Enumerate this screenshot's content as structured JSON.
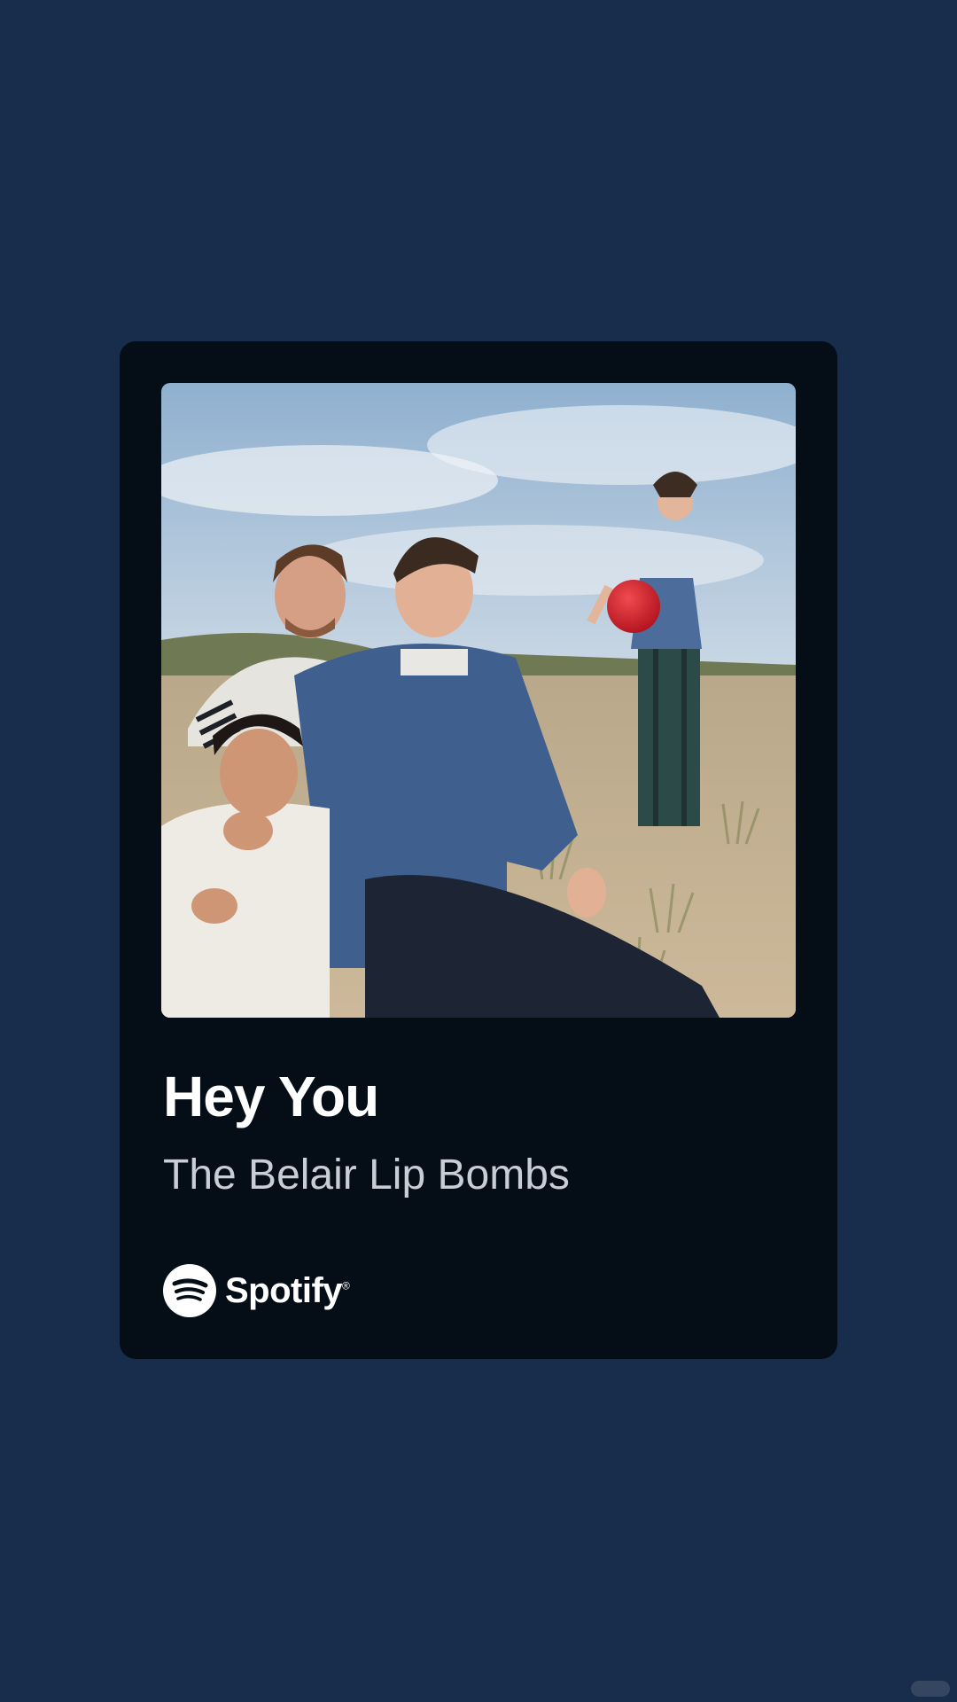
{
  "track": {
    "title": "Hey You",
    "artist": "The Belair Lip Bombs"
  },
  "brand": {
    "name": "Spotify",
    "icon": "spotify-logo-icon"
  },
  "artwork": {
    "description_icon": "album-cover-image"
  },
  "colors": {
    "background": "#182d4b",
    "card": "#050d17",
    "title": "#ffffff",
    "artist": "#c9ced6"
  }
}
